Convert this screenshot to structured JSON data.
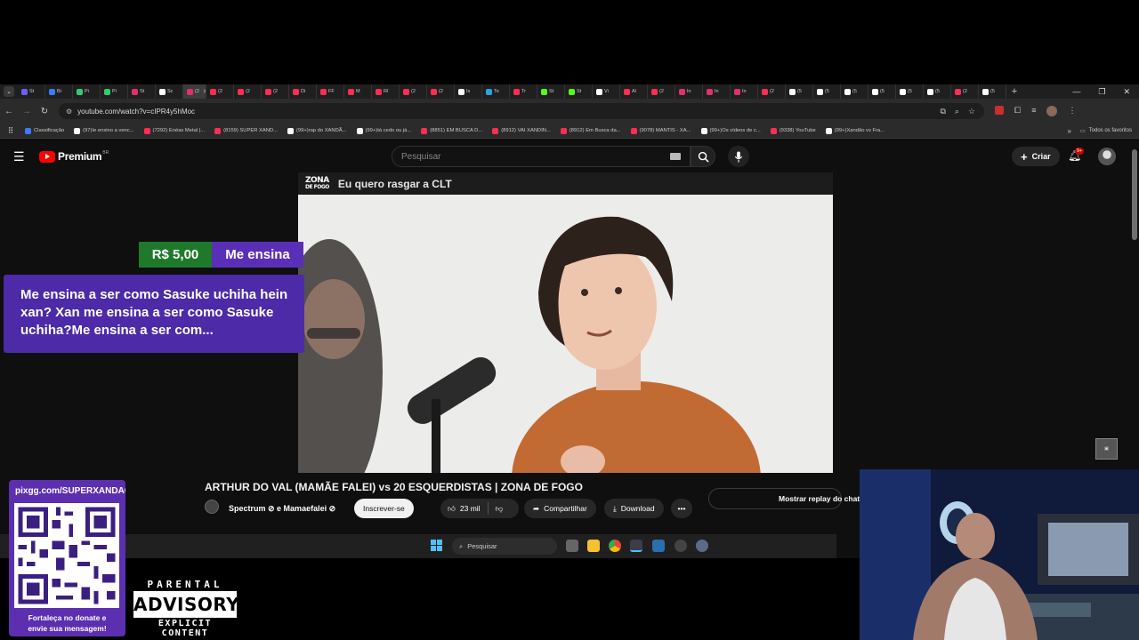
{
  "browser": {
    "tabs": [
      {
        "label": "St",
        "color": "#6f5cff"
      },
      {
        "label": "Bi",
        "color": "#3b7bff"
      },
      {
        "label": "Pi",
        "color": "#2ecc71"
      },
      {
        "label": "Pi",
        "color": "#2ecc71"
      },
      {
        "label": "St",
        "color": "#e1306c"
      },
      {
        "label": "Sc",
        "color": "#ffffff"
      },
      {
        "label": "(2",
        "color": "#e1306c"
      },
      {
        "label": "(2",
        "color": "#ff2d55"
      },
      {
        "label": "(2",
        "color": "#ff2d55"
      },
      {
        "label": "(2",
        "color": "#ff2d55"
      },
      {
        "label": "Di",
        "color": "#ff2d55"
      },
      {
        "label": "FF",
        "color": "#ff2d55"
      },
      {
        "label": "M",
        "color": "#ff2d55"
      },
      {
        "label": "RI",
        "color": "#ff2d55"
      },
      {
        "label": "(2",
        "color": "#ff2d55"
      },
      {
        "label": "(2",
        "color": "#ff2d55"
      },
      {
        "label": "Is",
        "color": "#ffffff"
      },
      {
        "label": "Te",
        "color": "#2aa3e0"
      },
      {
        "label": "Tr",
        "color": "#ff2d55"
      },
      {
        "label": "St",
        "color": "#53fc18"
      },
      {
        "label": "St",
        "color": "#53fc18"
      },
      {
        "label": "Vi",
        "color": "#ffffff"
      },
      {
        "label": "Al",
        "color": "#ff2d55"
      },
      {
        "label": "(2",
        "color": "#ff2d55"
      },
      {
        "label": "In",
        "color": "#e1306c"
      },
      {
        "label": "In",
        "color": "#e1306c"
      },
      {
        "label": "In",
        "color": "#e1306c"
      },
      {
        "label": "(2",
        "color": "#ff2d55"
      },
      {
        "label": "(5",
        "color": "#ffffff"
      },
      {
        "label": "(5",
        "color": "#ffffff"
      },
      {
        "label": "(5",
        "color": "#ffffff"
      },
      {
        "label": "(5",
        "color": "#ffffff"
      },
      {
        "label": "(5",
        "color": "#ffffff"
      },
      {
        "label": "(5",
        "color": "#ffffff"
      },
      {
        "label": "(2",
        "color": "#ff2d55"
      },
      {
        "label": "(5",
        "color": "#ffffff"
      }
    ],
    "address": "youtube.com/watch?v=cIPR4y5hMoc",
    "bookmarks": [
      {
        "label": "Classificação",
        "color": "#3b7bff"
      },
      {
        "label": "(97)Ie ensino a venc...",
        "color": "#ffffff"
      },
      {
        "label": "(7292) Enéas Metal |...",
        "color": "#ff2d55"
      },
      {
        "label": "(8159) SUPER XAND...",
        "color": "#ff2d55"
      },
      {
        "label": "(99+)rap do XANDÃ...",
        "color": "#ffffff"
      },
      {
        "label": "(99+)tá cedo ou já...",
        "color": "#ffffff"
      },
      {
        "label": "(8851) EM BUSCA D...",
        "color": "#ff2d55"
      },
      {
        "label": "(8912) VAI XANDIN...",
        "color": "#ff2d55"
      },
      {
        "label": "(8912) Em Busca da...",
        "color": "#ff2d55"
      },
      {
        "label": "(9078) MANTIS - XA...",
        "color": "#ff2d55"
      },
      {
        "label": "(99+)Os vídeos de c...",
        "color": "#ffffff"
      },
      {
        "label": "(9338) YouTube",
        "color": "#ff2d55"
      },
      {
        "label": "(99+)Xandão vs Fra...",
        "color": "#ffffff"
      }
    ],
    "all_bookmarks": "Todos os favoritos"
  },
  "youtube": {
    "logo_text": "Premium",
    "region": "BR",
    "search_placeholder": "Pesquisar",
    "create_label": "Criar",
    "notif_badge": "9+",
    "video_bar_logo_line1": "ZONA",
    "video_bar_logo_line2": "DE FOGO",
    "video_bar_caption": "Eu quero rasgar a CLT",
    "video_title": "ARTHUR DO VAL (MAMÃE FALEI) vs 20 ESQUERDISTAS | ZONA DE FOGO",
    "channel": "Spectrum ⊘ e Mamaefalei ⊘",
    "subscribe_label": "Inscrever-se",
    "likes": "23 mil",
    "share_label": "Compartilhar",
    "download_label": "Download",
    "replay_label": "Mostrar replay do chat"
  },
  "superchat": {
    "amount": "R$ 5,00",
    "title": "Me ensina",
    "message": "Me ensina a ser como Sasuke uchiha hein xan? Xan me ensina a ser como Sasuke uchiha?Me ensina a ser com..."
  },
  "taskbar": {
    "search_placeholder": "Pesquisar"
  },
  "overlay": {
    "donate_url": "pixgg.com/SUPERXANDAO",
    "donate_footer_line1": "Fortaleça no donate e",
    "donate_footer_line2": "envie sua mensagem!",
    "advisory_top": "PARENTAL",
    "advisory_mid": "ADVISORY",
    "advisory_bottom": "EXPLICIT CONTENT"
  },
  "colors": {
    "superchat_green": "#1e7a2a",
    "superchat_purple": "#5a2fb8",
    "youtube_red": "#ff0000"
  }
}
